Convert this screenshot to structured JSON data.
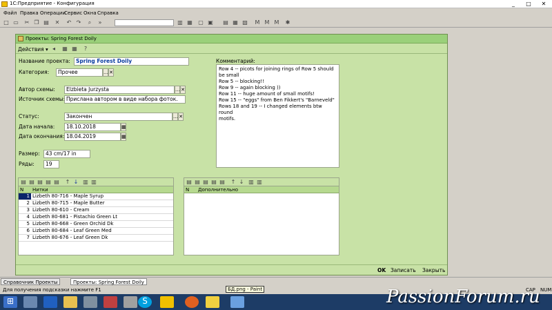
{
  "app_title": "1С:Предприятие - Конфигурация",
  "window_controls": {
    "min": "_",
    "max": "□",
    "close": "✕"
  },
  "menu": [
    "Файл",
    "Правка",
    "Операции",
    "Сервис",
    "Окна",
    "Справка"
  ],
  "form": {
    "title": "Проекты: Spring Forest Doily",
    "actions_label": "Действия ▾",
    "fields": {
      "name_label": "Название проекта:",
      "name_value": "Spring Forest Doily",
      "category_label": "Категория:",
      "category_value": "Прочее",
      "author_label": "Автор схемы:",
      "author_value": "Elzbieta Jurzysta",
      "source_label": "Источник схемы:",
      "source_value": "Прислана автором в виде набора фоток.",
      "status_label": "Статус:",
      "status_value": "Закончен",
      "start_label": "Дата начала:",
      "start_value": "18.10.2018",
      "end_label": "Дата окончания:",
      "end_value": "18.04.2019",
      "size_label": "Размер:",
      "size_value": "43 cm/17 in",
      "rows_label": "Ряды:",
      "rows_value": "19"
    },
    "comment_label": "Комментарий:",
    "comment_lines": [
      "Row 4 -- picots for joining rings of Row 5 should",
      "be small",
      "Row 5 -- blocking!!",
      "Row 9 -- again blocking ))",
      "Row 11 -- huge amount of small motifs!",
      "Row 15 -- \"eggs\" from Ben Fikkert's \"Barneveld\"",
      "Rows 18 and 19 -- I changed elements btw round",
      "motifs."
    ],
    "threads_table": {
      "col_n": "N",
      "col_name": "Нитки",
      "rows": [
        {
          "n": "1",
          "name": "Lizbeth 80-716 - Maple Syrup"
        },
        {
          "n": "2",
          "name": "Lizbeth 80-715 - Maple Butter"
        },
        {
          "n": "3",
          "name": "Lizbeth 80-610 - Cream"
        },
        {
          "n": "4",
          "name": "Lizbeth 80-681 - Pistachio Green Lt"
        },
        {
          "n": "5",
          "name": "Lizbeth 80-668 - Green Orchid Dk"
        },
        {
          "n": "6",
          "name": "Lizbeth 80-684 - Leaf Green Med"
        },
        {
          "n": "7",
          "name": "Lizbeth 80-676 - Leaf Green Dk"
        }
      ]
    },
    "extra_table": {
      "col_n": "N",
      "col_name": "Дополнительно"
    },
    "buttons": {
      "ok": "OK",
      "save": "Записать",
      "close": "Закрыть"
    }
  },
  "window_tabs": [
    "Справочник Проекты",
    "Проекты: Spring Forest Doily"
  ],
  "status_text": "Для получения подсказки нажмите F1",
  "status_right": [
    "CAP",
    "NUM"
  ],
  "tooltip": "БД.png - Paint",
  "watermark": "PassionForum.ru",
  "colors": {
    "form_bg": "#c8e2a6",
    "form_title": "#9ad07a",
    "taskbar": "#1d3c66",
    "selection": "#0a246a"
  }
}
